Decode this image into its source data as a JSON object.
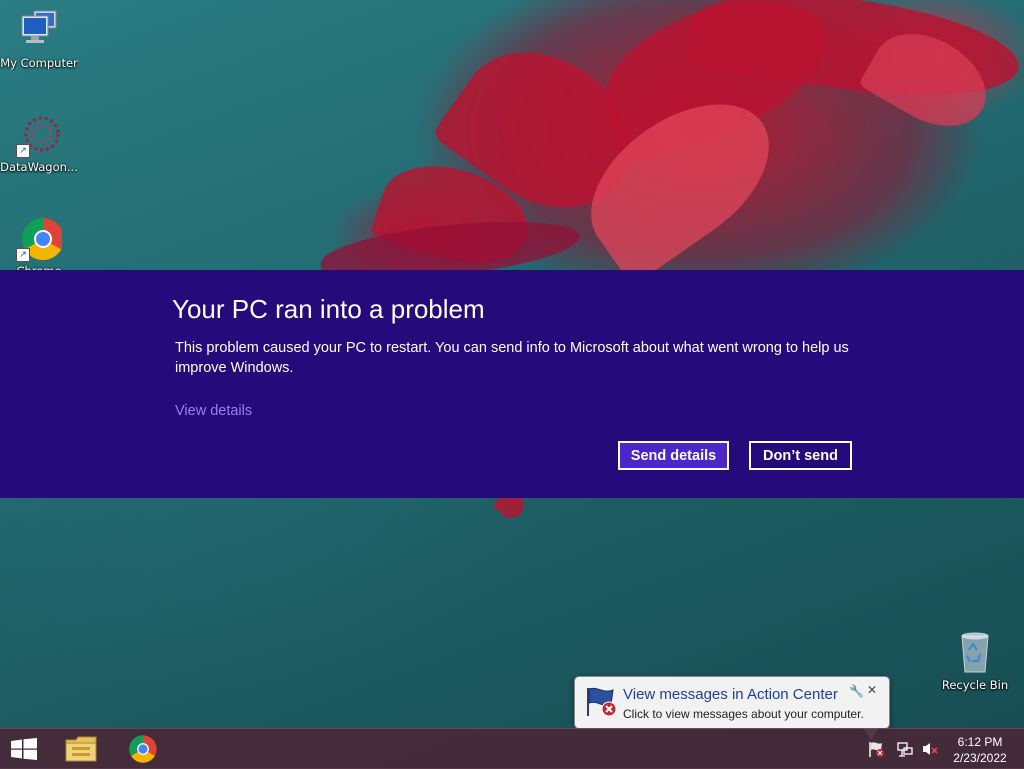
{
  "desktop": {
    "icons": [
      {
        "label": "My Computer",
        "icon": "computer-icon"
      },
      {
        "label": "DataWagon...",
        "icon": "datawagon-icon"
      },
      {
        "label": "Chrome",
        "icon": "chrome-icon"
      },
      {
        "label": "Recycle Bin",
        "icon": "recycle-bin-icon"
      }
    ]
  },
  "error_dialog": {
    "title": "Your PC ran into a problem",
    "message": "This problem caused your PC to restart. You can send info to Microsoft about what went wrong to help us improve Windows.",
    "view_details": "View details",
    "send_button": "Send details",
    "dont_send_button": "Don’t send",
    "background_color": "#240a7a",
    "accent_color": "#4b26c8"
  },
  "notification": {
    "title": "View messages in Action Center",
    "text": "Click to view messages about your computer.",
    "icon": "action-center-flag-icon"
  },
  "taskbar": {
    "items": [
      "start-icon",
      "file-explorer-icon",
      "chrome-icon"
    ],
    "tray_icons": [
      "action-center-flag-icon",
      "network-icon",
      "volume-muted-icon"
    ],
    "clock": {
      "time": "6:12 PM",
      "date": "2/23/2022"
    }
  }
}
